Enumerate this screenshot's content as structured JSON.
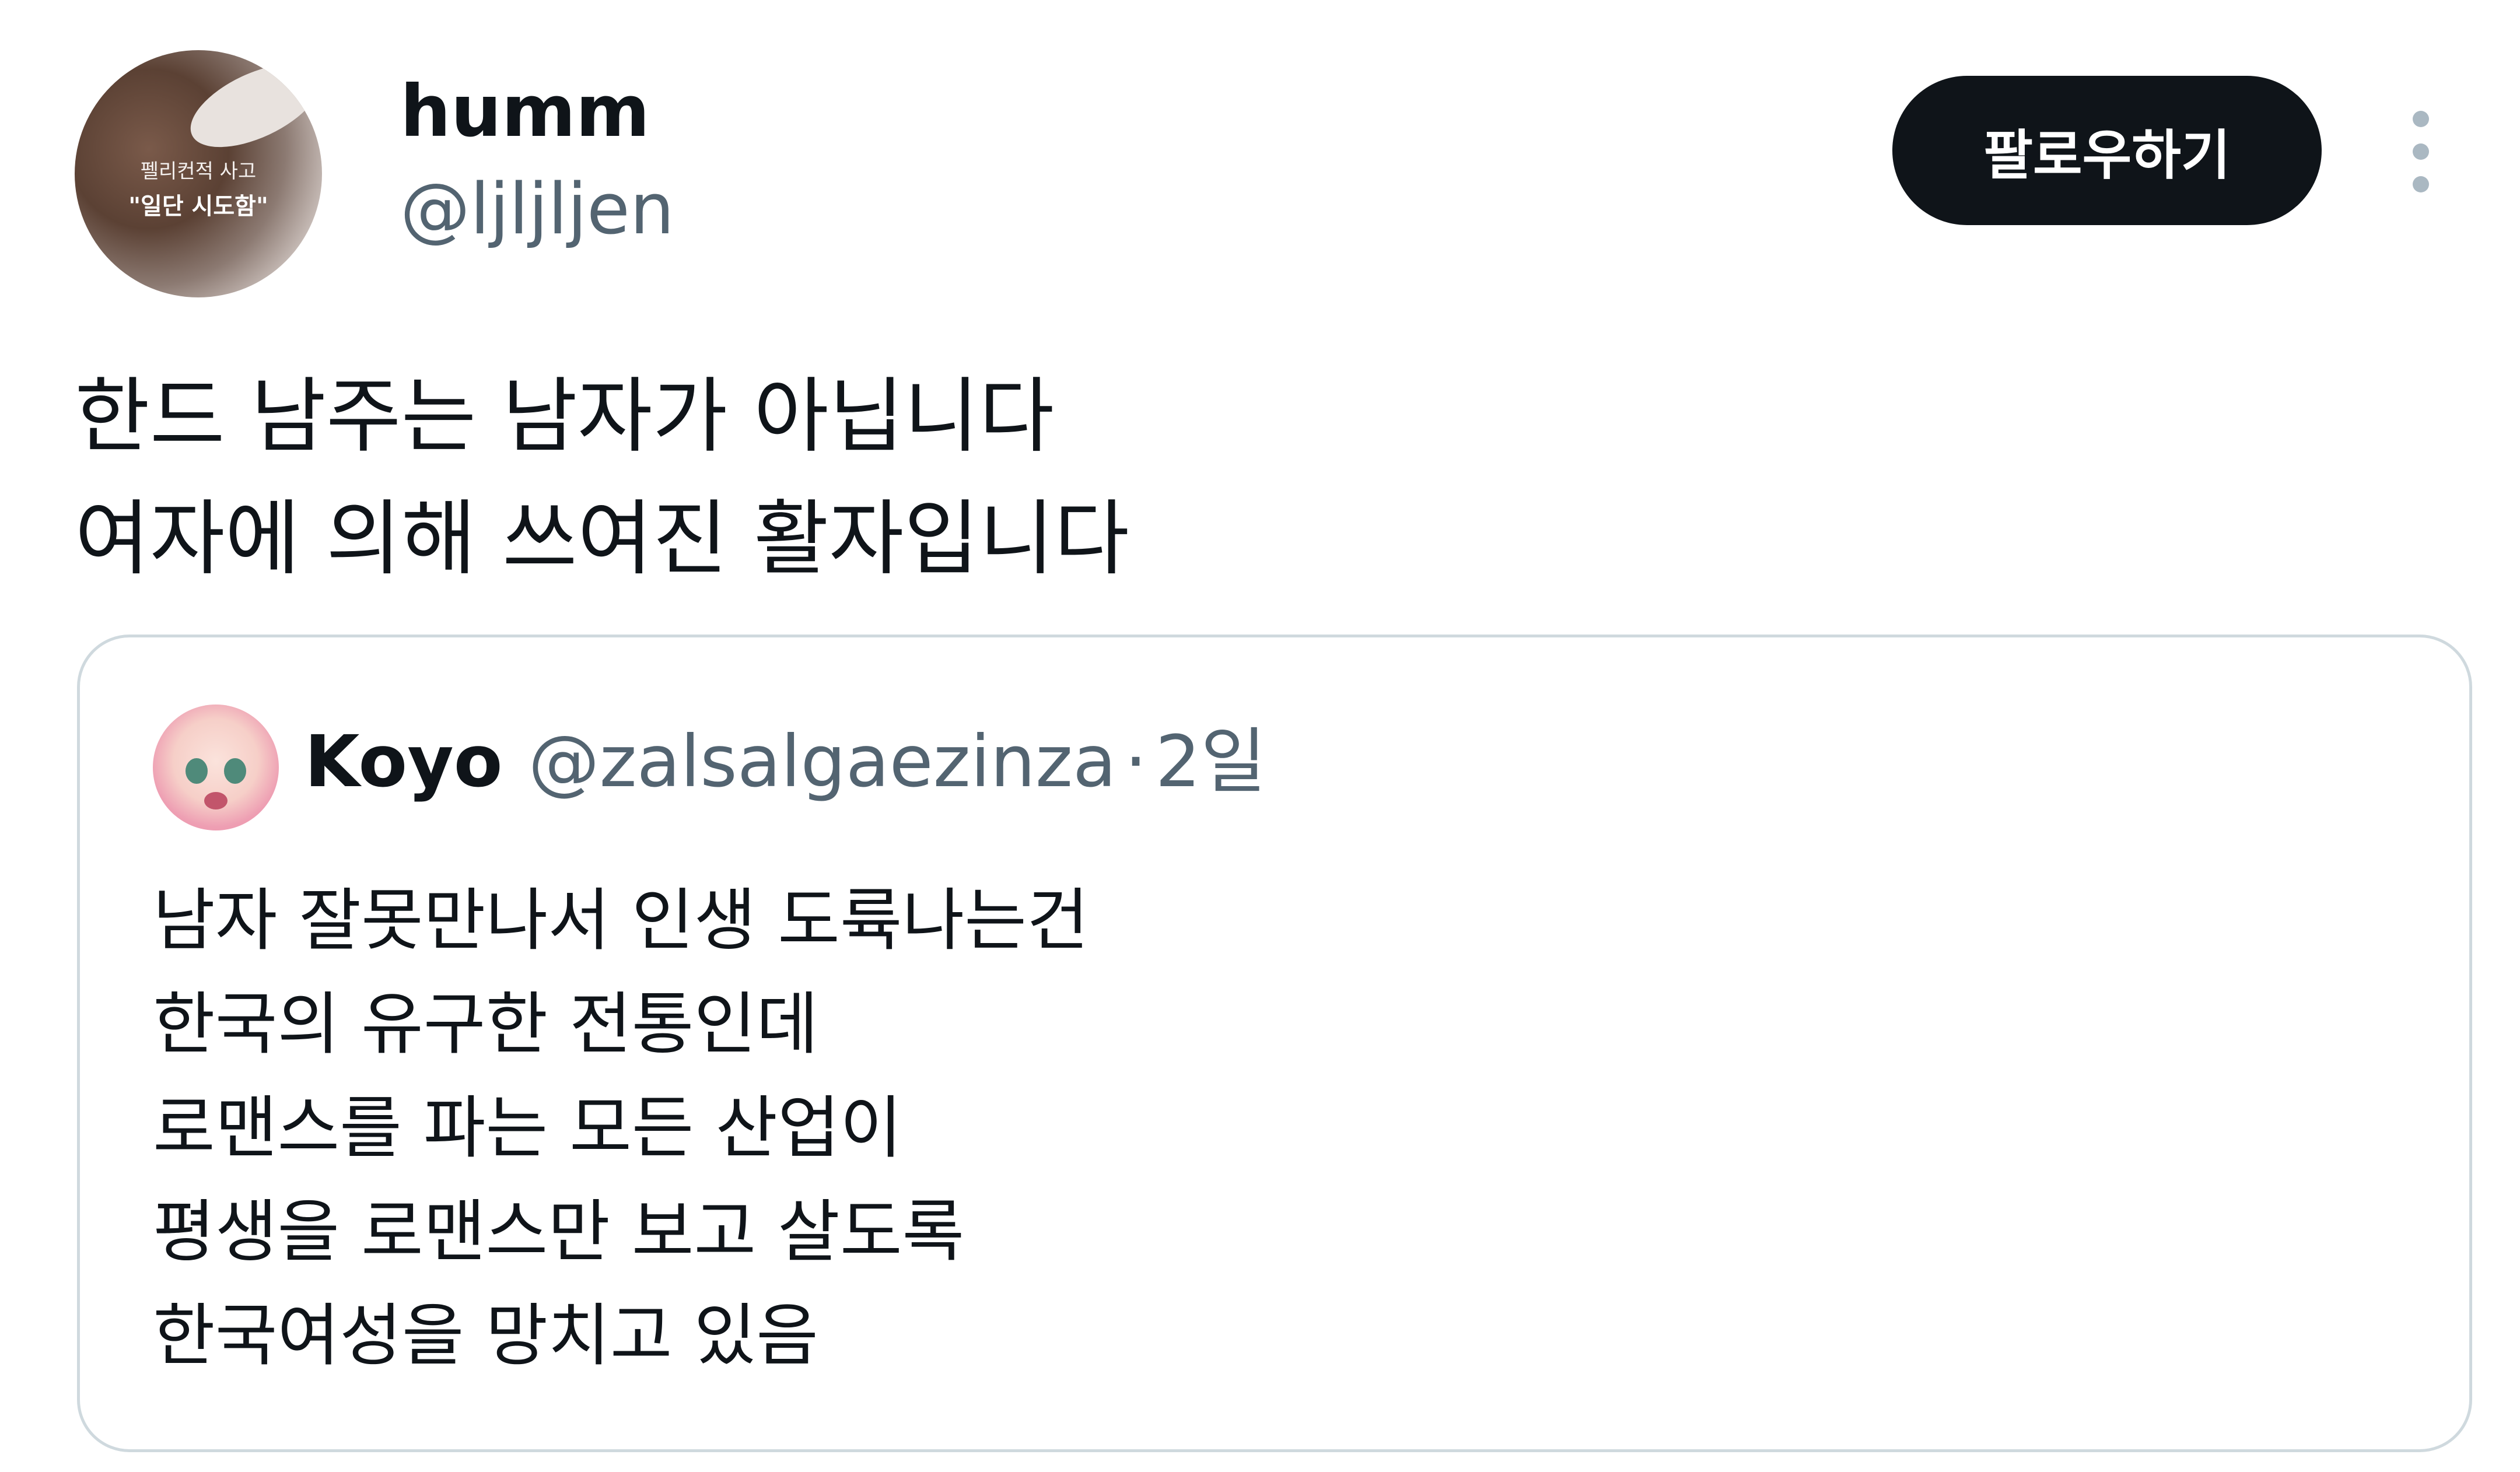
{
  "author": {
    "display_name": "humm",
    "handle": "@ljljljen",
    "avatar_caption_line1": "펠리컨적 사고",
    "avatar_caption_line2": "\"일단 시도함\""
  },
  "follow_label": "팔로우하기",
  "more_icon": "more-vertical-icon",
  "tweet": {
    "lines": [
      "한드 남주는 남자가 아닙니다",
      "여자에 의해 쓰여진 활자입니다"
    ]
  },
  "quote": {
    "display_name": "Koyo",
    "handle": "@zalsalgaezinza",
    "separator": "·",
    "time": "2일",
    "lines": [
      "남자 잘못만나서 인생 도륙나는건",
      "한국의 유구한 전통인데",
      "로맨스를 파는 모든 산업이",
      "평생을 로맨스만 보고 살도록",
      "한국여성을 망치고 있음"
    ]
  },
  "colors": {
    "text": "#0f1419",
    "secondary": "#536471",
    "border": "#cfd9de",
    "button_bg": "#0f1419",
    "button_text": "#ffffff"
  }
}
